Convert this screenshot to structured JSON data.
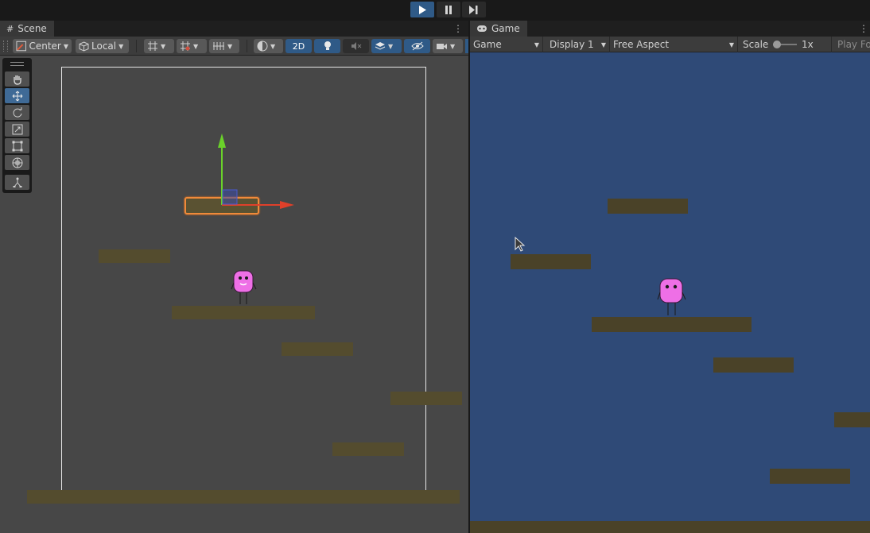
{
  "playbar": {
    "play": "play-icon",
    "pause": "pause-icon",
    "step": "step-icon"
  },
  "scene": {
    "tab_label": "Scene",
    "toolbar": {
      "pivot_label": "Center",
      "space_label": "Local",
      "mode_2d_label": "2D"
    },
    "tools": [
      "hand-icon",
      "move-icon",
      "rotate-icon",
      "scale-icon",
      "rect-icon",
      "transform-icon",
      "custom-icon"
    ]
  },
  "game": {
    "tab_label": "Game",
    "view_dropdown": "Game",
    "display_dropdown": "Display 1",
    "aspect_dropdown": "Free Aspect",
    "scale_label": "Scale",
    "scale_value": "1x",
    "play_focus_label": "Play Fo"
  },
  "colors": {
    "accent": "#2f5a87",
    "scene_bg": "#474747",
    "game_bg": "#2f4a77",
    "platform": "#544c2e",
    "selection": "#f08a3a",
    "character": "#ee6fe6"
  }
}
